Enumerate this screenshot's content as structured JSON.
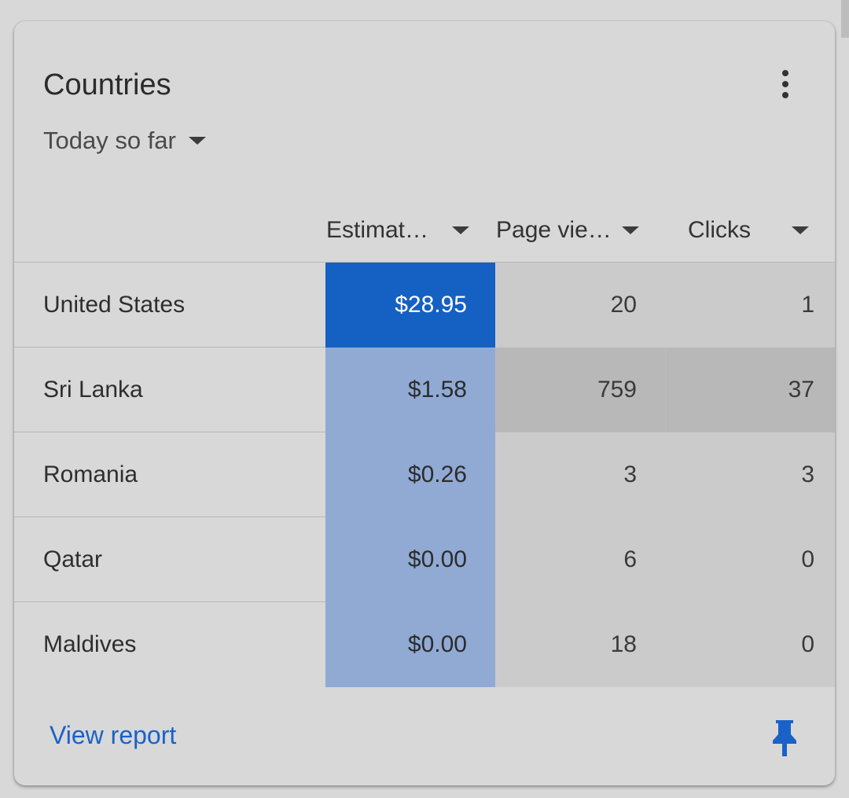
{
  "card": {
    "title": "Countries",
    "date_range": "Today so far",
    "menu_icon": "more-vert-icon"
  },
  "table": {
    "columns": [
      {
        "label": "Estimat…"
      },
      {
        "label": "Page vie…"
      },
      {
        "label": "Clicks"
      }
    ],
    "rows": [
      {
        "country": "United States",
        "estimated": "$28.95",
        "page_views": "20",
        "clicks": "1"
      },
      {
        "country": "Sri Lanka",
        "estimated": "$1.58",
        "page_views": "759",
        "clicks": "37"
      },
      {
        "country": "Romania",
        "estimated": "$0.26",
        "page_views": "3",
        "clicks": "3"
      },
      {
        "country": "Qatar",
        "estimated": "$0.00",
        "page_views": "6",
        "clicks": "0"
      },
      {
        "country": "Maldives",
        "estimated": "$0.00",
        "page_views": "18",
        "clicks": "0"
      }
    ]
  },
  "footer": {
    "view_report": "View report",
    "pin_icon": "pin-icon"
  },
  "colors": {
    "accent": "#1a62c7",
    "highlight_cell": "#1560c3",
    "estimated_column": "#90aad4"
  }
}
